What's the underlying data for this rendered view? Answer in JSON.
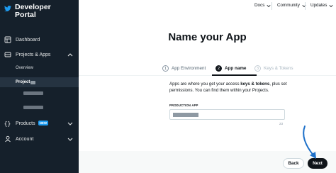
{
  "brand": {
    "title_line1": "Developer",
    "title_line2": "Portal"
  },
  "sidebar": {
    "items": [
      {
        "label": "Dashboard"
      },
      {
        "label": "Projects & Apps"
      },
      {
        "label": "Overview"
      },
      {
        "label": "Project"
      },
      {
        "label": "Products",
        "badge": "NEW"
      },
      {
        "label": "Account"
      }
    ]
  },
  "topnav": {
    "docs": "Docs",
    "community": "Community",
    "updates": "Updates"
  },
  "main": {
    "title": "Name your App",
    "steps": [
      {
        "number": "1",
        "label": "App Environment",
        "state": "complete"
      },
      {
        "number": "2",
        "label": "App name",
        "state": "active"
      },
      {
        "number": "3",
        "label": "Keys & Tokens",
        "state": "disabled"
      }
    ],
    "description_part1": "Apps are where you get your access ",
    "description_bold": "keys & tokens",
    "description_part2": ", plus set permissions. You can find them within your Projects.",
    "field_label": "PRODUCTION APP",
    "char_counter": "23",
    "back_label": "Back",
    "next_label": "Next"
  },
  "colors": {
    "sidebar_bg": "#15202b",
    "accent": "#1d9bf0",
    "primary_button": "#0f1419",
    "annotation_arrow": "#1d70c9"
  }
}
